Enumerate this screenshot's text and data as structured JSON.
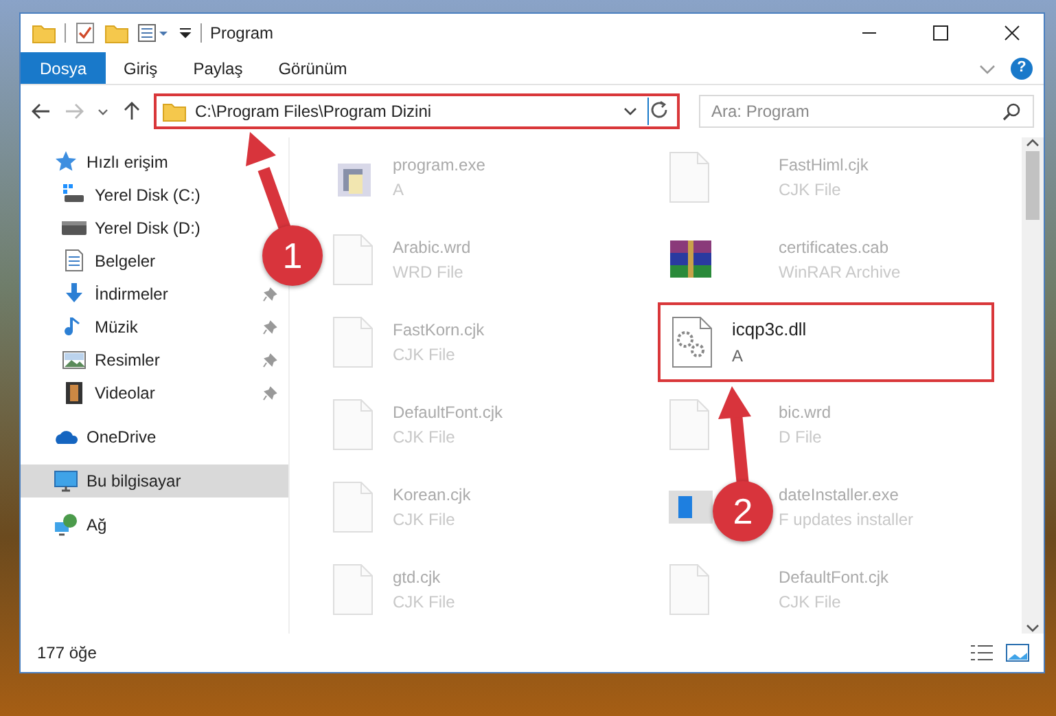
{
  "window": {
    "title": "Program"
  },
  "ribbon": {
    "tabs": [
      {
        "label": "Dosya",
        "selected": true
      },
      {
        "label": "Giriş",
        "selected": false
      },
      {
        "label": "Paylaş",
        "selected": false
      },
      {
        "label": "Görünüm",
        "selected": false
      }
    ],
    "help": "?"
  },
  "address_bar": {
    "path": "C:\\Program Files\\Program Dizini",
    "highlighted": true
  },
  "search": {
    "placeholder": "Ara: Program"
  },
  "navigation": [
    {
      "label": "Hızlı erişim",
      "kind": "star",
      "selected": false,
      "children": [
        {
          "label": "Yerel Disk (C:)",
          "kind": "drive-windows",
          "selected": false,
          "pinned": false
        },
        {
          "label": "Yerel Disk (D:)",
          "kind": "drive",
          "selected": false,
          "pinned": false
        },
        {
          "label": "Belgeler",
          "kind": "documents",
          "selected": false,
          "pinned": false
        },
        {
          "label": "İndirmeler",
          "kind": "download",
          "selected": false,
          "pinned": true
        },
        {
          "label": "Müzik",
          "kind": "music",
          "selected": false,
          "pinned": true
        },
        {
          "label": "Resimler",
          "kind": "pictures",
          "selected": false,
          "pinned": true
        },
        {
          "label": "Videolar",
          "kind": "video",
          "selected": false,
          "pinned": true
        }
      ]
    },
    {
      "label": "OneDrive",
      "kind": "cloud",
      "selected": false
    },
    {
      "label": "Bu bilgisayar",
      "kind": "computer",
      "selected": true
    },
    {
      "label": "Ağ",
      "kind": "network",
      "selected": false
    }
  ],
  "files": [
    {
      "name": "program.exe",
      "type": "A",
      "kind": "app",
      "highlighted": false
    },
    {
      "name": "FastHiml.cjk",
      "type": "CJK File",
      "kind": "blank",
      "highlighted": false
    },
    {
      "name": "Arabic.wrd",
      "type": "WRD File",
      "kind": "blank",
      "highlighted": false
    },
    {
      "name": "certificates.cab",
      "type": "WinRAR Archive",
      "kind": "archive",
      "highlighted": false
    },
    {
      "name": "FastKorn.cjk",
      "type": "CJK File",
      "kind": "blank",
      "highlighted": false
    },
    {
      "name": "icqp3c.dll",
      "type": "A",
      "kind": "dll",
      "highlighted": true
    },
    {
      "name": "DefaultFont.cjk",
      "type": "CJK File",
      "kind": "blank",
      "highlighted": false
    },
    {
      "name": "bic.wrd",
      "type": "D File",
      "kind": "blank",
      "highlighted": false
    },
    {
      "name": "Korean.cjk",
      "type": "CJK File",
      "kind": "blank",
      "highlighted": false
    },
    {
      "name": "dateInstaller.exe",
      "type": "F updates installer",
      "kind": "installer",
      "highlighted": false
    },
    {
      "name": "gtd.cjk",
      "type": "CJK File",
      "kind": "blank",
      "highlighted": false
    },
    {
      "name": "DefaultFont.cjk",
      "type": "CJK File",
      "kind": "blank",
      "highlighted": false
    }
  ],
  "annotations": [
    {
      "label": "1"
    },
    {
      "label": "2"
    }
  ],
  "status_bar": {
    "count": "177 öğe"
  }
}
